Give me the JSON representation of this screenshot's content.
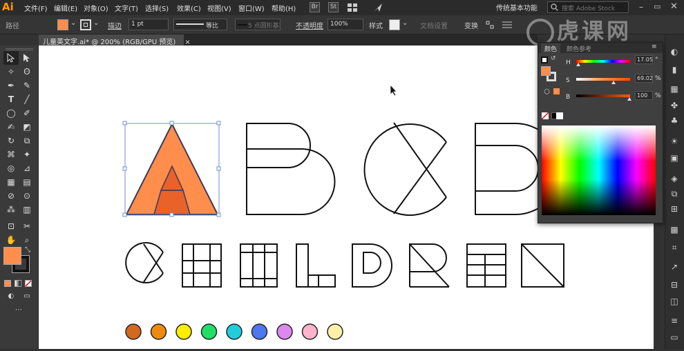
{
  "app": {
    "logo": "Ai"
  },
  "menu": [
    "文件(F)",
    "编辑(E)",
    "对象(O)",
    "文字(T)",
    "选择(S)",
    "效果(C)",
    "视图(V)",
    "窗口(W)",
    "帮助(H)"
  ],
  "menubar_icons": {
    "bridge": "Br",
    "stock": "St"
  },
  "workspace": {
    "label": "传统基本功能"
  },
  "search": {
    "placeholder": "搜索 Adobe Stock"
  },
  "control_bar": {
    "selection_label": "路径",
    "stroke_label": "描边",
    "stroke_weight": "1 pt",
    "profile_label": "等比",
    "brush_label": "5 点圆形",
    "brush_suffix": "基本",
    "opacity_label": "不透明度",
    "opacity_value": "100%",
    "style_label": "样式",
    "doc_setup": "文档设置",
    "transform": "变换"
  },
  "document": {
    "tab_title": "儿童英文字.ai* @ 200% (RGB/GPU 预览)",
    "close": "×"
  },
  "watermark": "虎课网",
  "color_panel": {
    "tabs": [
      "颜色",
      "颜色参考"
    ],
    "sliders": [
      {
        "label": "H",
        "value": "17.05",
        "unit": "°",
        "position": 0.05
      },
      {
        "label": "S",
        "value": "69.02",
        "unit": "%",
        "position": 0.69
      },
      {
        "label": "B",
        "value": "100",
        "unit": "%",
        "position": 1.0
      }
    ]
  },
  "colors": {
    "fill": "#ff8d4c",
    "fill_dark": "#e8622a",
    "swatches": [
      "#d2691e",
      "#ee8a10",
      "#ffee00",
      "#22dd66",
      "#22ccdd",
      "#4f78ee",
      "#dd88ee",
      "#ffb3cc",
      "#fff2a8"
    ]
  },
  "artwork": {
    "row1_letters": [
      "A",
      "B",
      "C",
      "D"
    ],
    "row2_letters": [
      "C",
      "H",
      "I",
      "L",
      "D",
      "R",
      "E",
      "N"
    ]
  }
}
